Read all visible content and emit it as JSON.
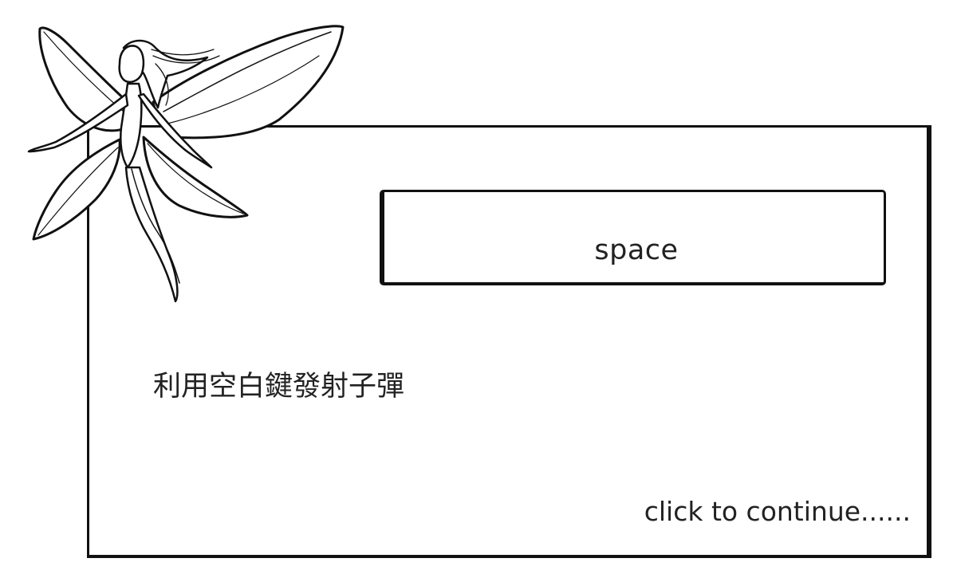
{
  "dialog": {
    "key_label": "space",
    "instruction": "利用空白鍵發射子彈",
    "continue_label": "click to continue......"
  },
  "illustration": {
    "icon": "fairy-icon"
  }
}
